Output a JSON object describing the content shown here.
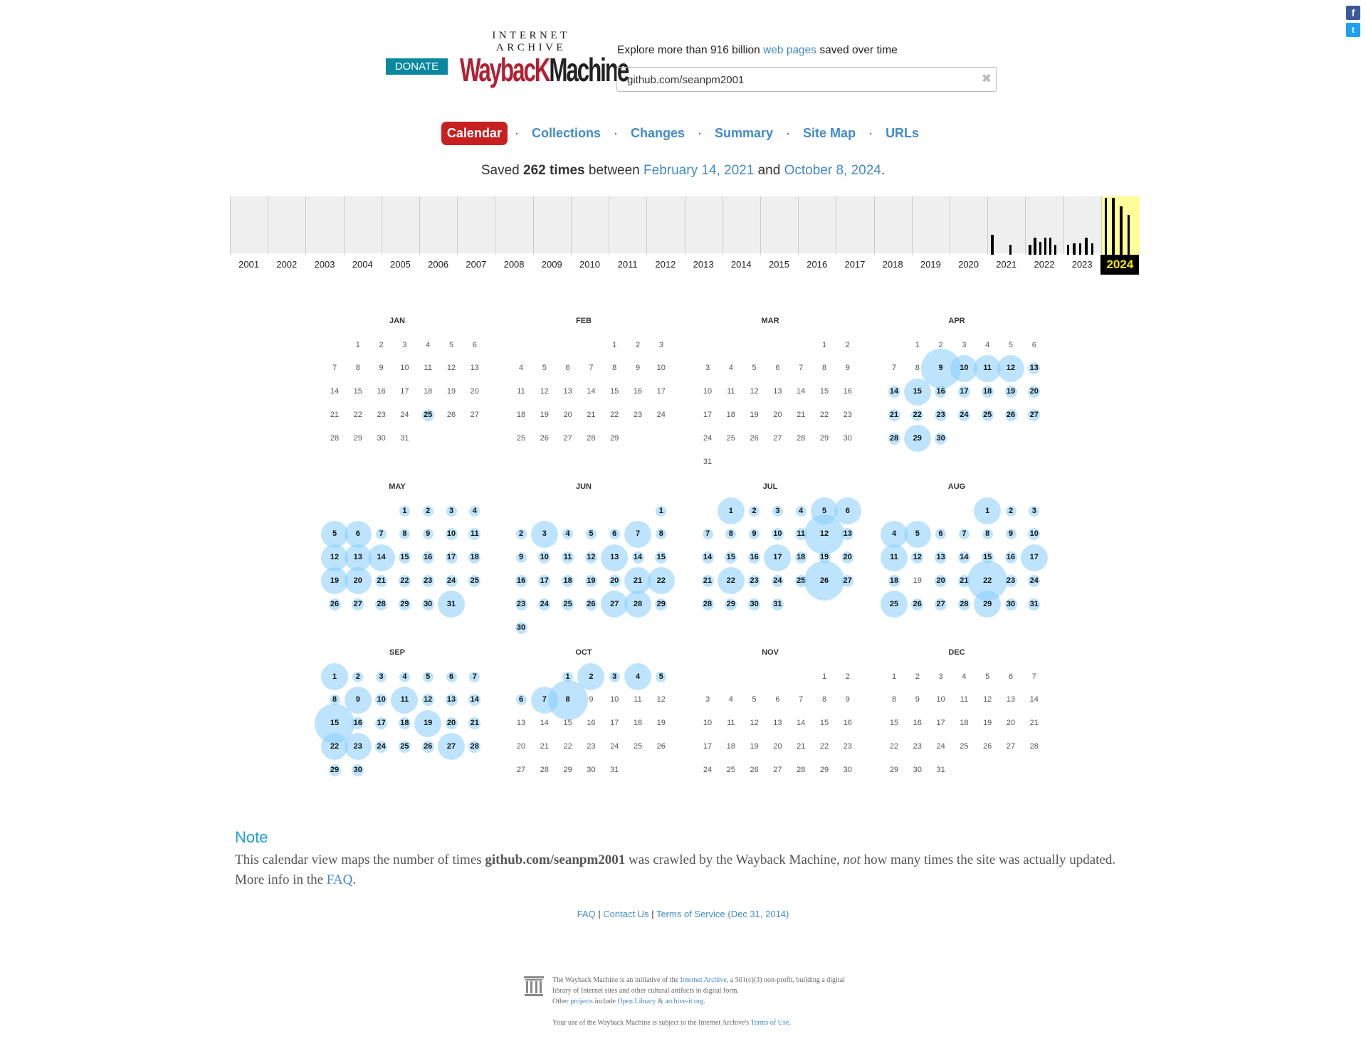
{
  "social": {
    "facebook": "f",
    "twitter": "t"
  },
  "header": {
    "donate": "DONATE",
    "logo_top": "INTERNET ARCHIVE",
    "logo_w": "WaybacK",
    "logo_m": "Machine",
    "explore_pre": "Explore more than 916 billion ",
    "explore_link": "web pages",
    "explore_post": " saved over time",
    "search_value": "github.com/seanpm2001",
    "clear_icon": "✖"
  },
  "tabs": [
    "Calendar",
    "Collections",
    "Changes",
    "Summary",
    "Site Map",
    "URLs"
  ],
  "saved": {
    "pre": "Saved ",
    "count": "262 times",
    "mid": " between ",
    "from": "February 14, 2021",
    "and": " and ",
    "to": "October 8, 2024",
    "end": "."
  },
  "years": [
    "2001",
    "2002",
    "2003",
    "2004",
    "2005",
    "2006",
    "2007",
    "2008",
    "2009",
    "2010",
    "2011",
    "2012",
    "2013",
    "2014",
    "2015",
    "2016",
    "2017",
    "2018",
    "2019",
    "2020",
    "2021",
    "2022",
    "2023",
    "2024"
  ],
  "current_year": "2024",
  "year_bars": {
    "2021": [
      0.35,
      0,
      0,
      0.18,
      0
    ],
    "2022": [
      0.18,
      0.3,
      0.22,
      0.3,
      0.3,
      0.18
    ],
    "2023": [
      0.18,
      0.2,
      0.2,
      0.3,
      0.2
    ],
    "2024": [
      1.0,
      1.0,
      0.85,
      0.7
    ]
  },
  "months": [
    {
      "name": "JAN",
      "start": 1,
      "days": 31,
      "caps": {
        "25": 1
      }
    },
    {
      "name": "FEB",
      "start": 4,
      "days": 29,
      "caps": {}
    },
    {
      "name": "MAR",
      "start": 5,
      "days": 31,
      "caps": {}
    },
    {
      "name": "APR",
      "start": 1,
      "days": 30,
      "caps": {
        "9": 3,
        "10": 2,
        "11": 2,
        "12": 2,
        "13": 1,
        "14": 1,
        "15": 2,
        "16": 1,
        "17": 1,
        "18": 1,
        "19": 1,
        "20": 1,
        "21": 1,
        "22": 1,
        "23": 1,
        "24": 1,
        "25": 1,
        "26": 1,
        "27": 1,
        "28": 1,
        "29": 2,
        "30": 1
      }
    },
    {
      "name": "MAY",
      "start": 3,
      "days": 31,
      "caps": {
        "1": 1,
        "2": 1,
        "3": 1,
        "4": 1,
        "5": 2,
        "6": 2,
        "7": 1,
        "8": 1,
        "9": 1,
        "10": 1,
        "11": 1,
        "12": 2,
        "13": 2,
        "14": 2,
        "15": 1,
        "16": 1,
        "17": 1,
        "18": 1,
        "19": 2,
        "20": 2,
        "21": 1,
        "22": 1,
        "23": 1,
        "24": 1,
        "25": 1,
        "26": 1,
        "27": 1,
        "28": 1,
        "29": 1,
        "30": 1,
        "31": 2
      }
    },
    {
      "name": "JUN",
      "start": 6,
      "days": 30,
      "caps": {
        "1": 1,
        "2": 1,
        "3": 2,
        "4": 1,
        "5": 1,
        "6": 1,
        "7": 2,
        "8": 1,
        "9": 1,
        "10": 1,
        "11": 1,
        "12": 1,
        "13": 2,
        "14": 1,
        "15": 1,
        "16": 1,
        "17": 1,
        "18": 1,
        "19": 1,
        "20": 1,
        "21": 2,
        "22": 2,
        "23": 1,
        "24": 1,
        "25": 1,
        "26": 1,
        "27": 2,
        "28": 2,
        "29": 1,
        "30": 1
      }
    },
    {
      "name": "JUL",
      "start": 1,
      "days": 31,
      "caps": {
        "1": 2,
        "2": 1,
        "3": 1,
        "4": 1,
        "5": 2,
        "6": 2,
        "7": 1,
        "8": 1,
        "9": 1,
        "10": 1,
        "11": 1,
        "12": 3,
        "13": 1,
        "14": 1,
        "15": 1,
        "16": 1,
        "17": 2,
        "18": 1,
        "19": 1,
        "20": 1,
        "21": 1,
        "22": 2,
        "23": 1,
        "24": 1,
        "25": 1,
        "26": 3,
        "27": 1,
        "28": 1,
        "29": 1,
        "30": 1,
        "31": 1
      }
    },
    {
      "name": "AUG",
      "start": 4,
      "days": 31,
      "caps": {
        "1": 2,
        "2": 1,
        "3": 1,
        "4": 2,
        "5": 2,
        "6": 1,
        "7": 1,
        "8": 1,
        "9": 1,
        "10": 1,
        "11": 2,
        "12": 1,
        "13": 1,
        "14": 1,
        "15": 1,
        "16": 1,
        "17": 2,
        "18": 1,
        "20": 1,
        "21": 1,
        "22": 3,
        "23": 1,
        "24": 1,
        "25": 2,
        "26": 1,
        "27": 1,
        "28": 1,
        "29": 2,
        "30": 1,
        "31": 1
      }
    },
    {
      "name": "SEP",
      "start": 0,
      "days": 30,
      "caps": {
        "1": 2,
        "2": 1,
        "3": 1,
        "4": 1,
        "5": 1,
        "6": 1,
        "7": 1,
        "8": 1,
        "9": 2,
        "10": 1,
        "11": 2,
        "12": 1,
        "13": 1,
        "14": 1,
        "15": 3,
        "16": 1,
        "17": 1,
        "18": 1,
        "19": 2,
        "20": 1,
        "21": 1,
        "22": 2,
        "23": 2,
        "24": 1,
        "25": 1,
        "26": 1,
        "27": 2,
        "28": 1,
        "29": 1,
        "30": 1
      }
    },
    {
      "name": "OCT",
      "start": 2,
      "days": 31,
      "caps": {
        "1": 1,
        "2": 2,
        "3": 1,
        "4": 2,
        "5": 1,
        "6": 1,
        "7": 2,
        "8": 3
      }
    },
    {
      "name": "NOV",
      "start": 5,
      "days": 30,
      "caps": {}
    },
    {
      "name": "DEC",
      "start": 0,
      "days": 31,
      "caps": {}
    }
  ],
  "note": {
    "title": "Note",
    "p1_pre": "This calendar view maps the number of times ",
    "p1_bold": "github.com/seanpm2001",
    "p1_mid": " was crawled by the Wayback Machine, ",
    "p1_em": "not",
    "p1_post": " how many times the site was actually updated.",
    "p2_pre": "More info in the ",
    "p2_link": "FAQ",
    "p2_post": "."
  },
  "footer": {
    "faq": "FAQ",
    "contact": "Contact Us",
    "tos": "Terms of Service (Dec 31, 2014)",
    "sep": " | "
  },
  "about": {
    "l1a": "The Wayback Machine is an initiative of the ",
    "l1link": "Internet Archive",
    "l1b": ", a 501(c)(3) non-profit, building a digital library of Internet sites and other cultural artifacts in digital form.",
    "l2a": "Other ",
    "l2link1": "projects",
    "l2b": " include ",
    "l2link2": "Open Library",
    "l2c": " & ",
    "l2link3": "archive-it.org",
    "l2d": ".",
    "l3a": "Your use of the Wayback Machine is subject to the Internet Archive's ",
    "l3link": "Terms of Use",
    "l3b": "."
  }
}
